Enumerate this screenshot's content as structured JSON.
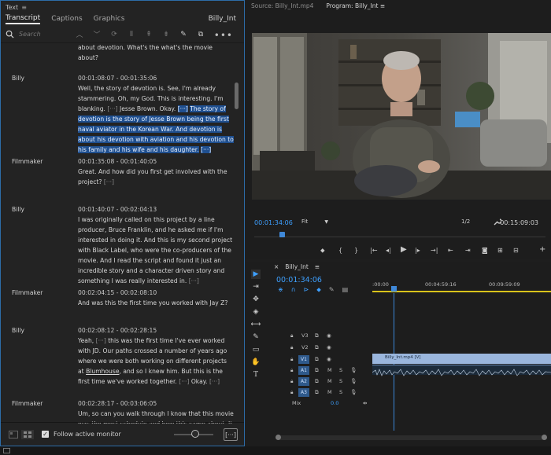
{
  "text_panel": {
    "title": "Text",
    "menu_glyph": "≡",
    "tabs": [
      "Transcript",
      "Captions",
      "Graphics"
    ],
    "clip_name": "Billy_Int",
    "search_placeholder": "Search",
    "more_glyph": "•••",
    "partial_line": "about devotion. What's the what's the movie about?",
    "segments": [
      {
        "speaker": "Billy",
        "timecode": "00:01:08:07 - 00:01:35:06",
        "pre": "Well, the story of devotion is. See, I'm already stammering. Oh, my God. This is interesting. I'm blanking.",
        "gap1": "[···]",
        "mid": "Jesse Brown. Okay.",
        "hl_gap": "[···]",
        "highlight": "The story of devotion is the story of Jesse Brown being the first naval aviator in the Korean War. And devotion is about his devotion with aviation and his devotion to his family and his wife and his daughter.",
        "hl_gap2": "[···]"
      },
      {
        "speaker": "Filmmaker",
        "timecode": "00:01:35:08 - 00:01:40:05",
        "text": "Great. And how did you first get involved with the project?",
        "gap": "[···]"
      },
      {
        "speaker": "Billy",
        "timecode": "00:01:40:07 - 00:02:04:13",
        "text": "I was originally called on this project by a line producer, Bruce Franklin, and he asked me if I'm interested in doing it. And this is my second project with Black Label, who were the co-producers of the movie. And I read the script and found it just an incredible story and a character driven story and something I was really interested in.",
        "gap": "[···]"
      },
      {
        "speaker": "Filmmaker",
        "timecode": "00:02:04:15 - 00:02:08:10",
        "text": "And was this the first time you worked with Jay Z?"
      },
      {
        "speaker": "Billy",
        "timecode": "00:02:08:12 - 00:02:28:15",
        "pre": "Yeah,",
        "gap1": "[···]",
        "mid": "this was the first time I've ever worked with JD. Our paths crossed a number of years ago where we were both working on different projects at",
        "link": "Blumhouse",
        "post": ", and so I knew him. But this is the first time we've worked together.",
        "gap2": "[···]",
        "tail": "Okay.",
        "gap3": "[···]"
      },
      {
        "speaker": "Filmmaker",
        "timecode": "00:02:28:17 - 00:03:06:05",
        "text": "Um, so can you walk through I know that this movie was the most schedule and how this came about. It was a little bit"
      }
    ],
    "footer": {
      "check_glyph": "✓",
      "follow_label": "Follow active monitor",
      "button_label": "[···]"
    }
  },
  "monitor": {
    "tabs": [
      {
        "label": "Source: Billy_Int.mp4",
        "menu": ""
      },
      {
        "label": "Program: Billy_Int",
        "menu": "≡"
      }
    ],
    "timecode": "00:01:34:06",
    "fit": "Fit",
    "resolution": "1/2",
    "duration": "00:15:09:03",
    "controls": [
      "⬥",
      "{",
      "}",
      "|←",
      "◂|",
      "▶",
      "|▸",
      "→|",
      "⇤",
      "⇥",
      "◙",
      "⊞",
      "⊟",
      "+"
    ]
  },
  "timeline": {
    "sequence_name": "Billy_Int",
    "menu_glyph": "≡",
    "close_glyph": "×",
    "timecode": "00:01:34:06",
    "ruler_labels": [
      ":00:00",
      "00:04:59:16",
      "00:09:59:09"
    ],
    "video_tracks": [
      "V3",
      "V2",
      "V1"
    ],
    "audio_tracks": [
      "A1",
      "A2",
      "A3"
    ],
    "track_letters": {
      "m": "M",
      "s": "S"
    },
    "mix_label": "Mix",
    "mix_value": "0.0",
    "clip_label": "Billy_Int.mp4 [V]",
    "tool_glyphs": [
      "▶",
      "⇥",
      "✥",
      "◈",
      "⟷",
      "✎",
      "▭",
      "✋",
      "T"
    ]
  },
  "colors": {
    "accent_blue": "#3ea0ff",
    "highlight": "#1f4f8f",
    "clip_video": "#9ab6dd",
    "work_area": "#d9c31a"
  }
}
